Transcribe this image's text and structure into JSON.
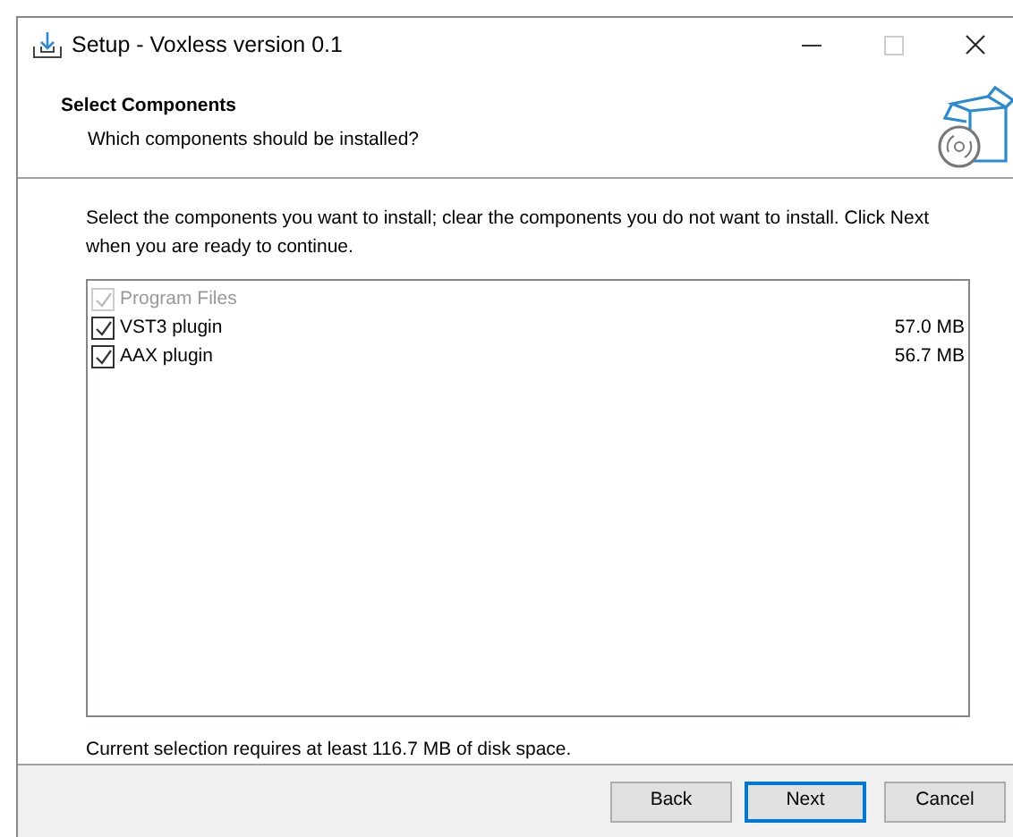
{
  "window": {
    "title": "Setup - Voxless version 0.1"
  },
  "header": {
    "title": "Select Components",
    "subtitle": "Which components should be installed?"
  },
  "instructions": "Select the components you want to install; clear the components you do not want to install. Click Next when you are ready to continue.",
  "components": [
    {
      "label": "Program Files",
      "checked": true,
      "disabled": true
    },
    {
      "label": "VST3 plugin",
      "checked": true,
      "disabled": false,
      "size": "57.0 MB"
    },
    {
      "label": "AAX plugin",
      "checked": true,
      "disabled": false,
      "size": "56.7 MB"
    }
  ],
  "status": "Current selection requires at least 116.7 MB of disk space.",
  "buttons": [
    {
      "label": "Back",
      "default": false
    },
    {
      "label": "Next",
      "default": true
    },
    {
      "label": "Cancel",
      "default": false
    }
  ]
}
